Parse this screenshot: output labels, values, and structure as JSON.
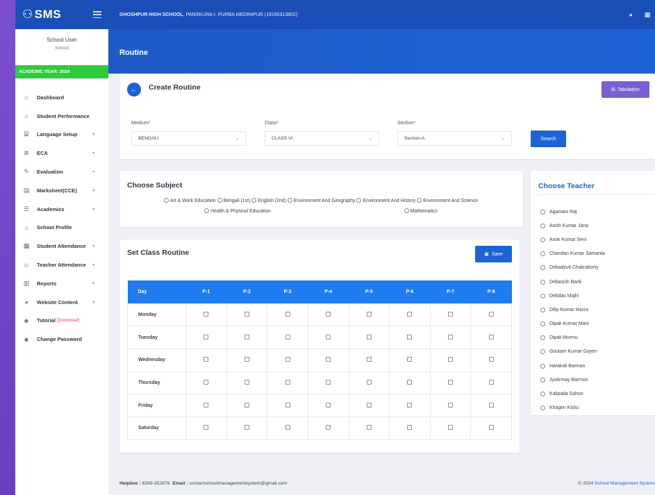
{
  "brand": {
    "name": "SMS"
  },
  "user": {
    "name": "School User",
    "role": "School"
  },
  "academic_year": "ACADEMIC YEAR: 2024",
  "topbar": {
    "school_name": "GHOSHPUR HIGH SCHOOL",
    "school_location": ", PANSKURA-I, PURBA MEDINIPUR (19190313802)"
  },
  "page_title": "Routine",
  "sidebar": {
    "items": [
      {
        "label": "Dashboard",
        "icon": "home-icon",
        "caret": false
      },
      {
        "label": "Student Performance",
        "icon": "home-icon",
        "caret": false
      },
      {
        "label": "Language Setup",
        "icon": "language-icon",
        "caret": true
      },
      {
        "label": "ECA",
        "icon": "layers-icon",
        "caret": true
      },
      {
        "label": "Evaluation",
        "icon": "edit-icon",
        "caret": true
      },
      {
        "label": "Marksheet(CCE)",
        "icon": "marksheet-icon",
        "caret": true
      },
      {
        "label": "Academics",
        "icon": "list-icon",
        "caret": true
      },
      {
        "label": "School Profile",
        "icon": "school-icon",
        "caret": false
      },
      {
        "label": "Student Attendance",
        "icon": "calendar-icon",
        "caret": true
      },
      {
        "label": "Teacher Attendance",
        "icon": "user-check-icon",
        "caret": true
      },
      {
        "label": "Reports",
        "icon": "chart-icon",
        "caret": true
      },
      {
        "label": "Website Content",
        "icon": "globe-icon",
        "caret": true
      },
      {
        "label": "Tutorial",
        "icon": "users-icon",
        "caret": false,
        "extra": "[Download]"
      },
      {
        "label": "Change Password",
        "icon": "users-icon",
        "caret": false
      }
    ]
  },
  "create": {
    "title": "Create Routine",
    "tabulation_label": "Tabulation",
    "medium_label": "Medium",
    "medium_value": "BENGALI",
    "class_label": "Class",
    "class_value": "CLASS VI",
    "section_label": "Section",
    "section_value": "Section-A",
    "required_mark": "*",
    "search_label": "Search"
  },
  "subjects": {
    "title": "Choose Subject",
    "items": [
      "Art & Work Education",
      "Bengali (1st)",
      "English (2nd)",
      "Environment And Geography",
      "Environment And History",
      "Environment And Science",
      "Health & Physical Education",
      "Mathematics"
    ]
  },
  "routine": {
    "title": "Set Class Routine",
    "save_label": "Save",
    "header_day": "Day",
    "periods": [
      "P-1",
      "P-2",
      "P-3",
      "P-4",
      "P-5",
      "P-6",
      "P-7",
      "P-8"
    ],
    "days": [
      "Monday",
      "Tuesday",
      "Wednesday",
      "Thursday",
      "Friday",
      "Saturday"
    ]
  },
  "teachers": {
    "title": "Choose Teacher",
    "items": [
      "Agamani Raj",
      "Asish Kumar Jana",
      "Asok Kumar Seni",
      "Chandan Kumar Samanta",
      "Debadyuti Chakraborty",
      "Debasish Barik",
      "Debdas Majhi",
      "Dilip Kumar Hazra",
      "Dipak Kumar Mani",
      "Dipali Murmu",
      "Goutam Kumar Gayen",
      "Harakali Barman",
      "Jyotirmay Barmon",
      "Kalipada Sahoo",
      "Khagen Kisku"
    ]
  },
  "footer": {
    "helpline_label": "Helpline :",
    "helpline_value": "6289-352676",
    "email_label": "Email :",
    "email_value": "contactschoolmanagementsystem@gmail.com",
    "copyright": "© 2024",
    "copyright_link": "School Management System"
  },
  "colors": {
    "primary": "#1e63d6",
    "topbar": "#1b4fb8",
    "year_bar": "#2ecc3b",
    "tabulation": "#7b5fd6",
    "background": "#7a4fd0"
  }
}
